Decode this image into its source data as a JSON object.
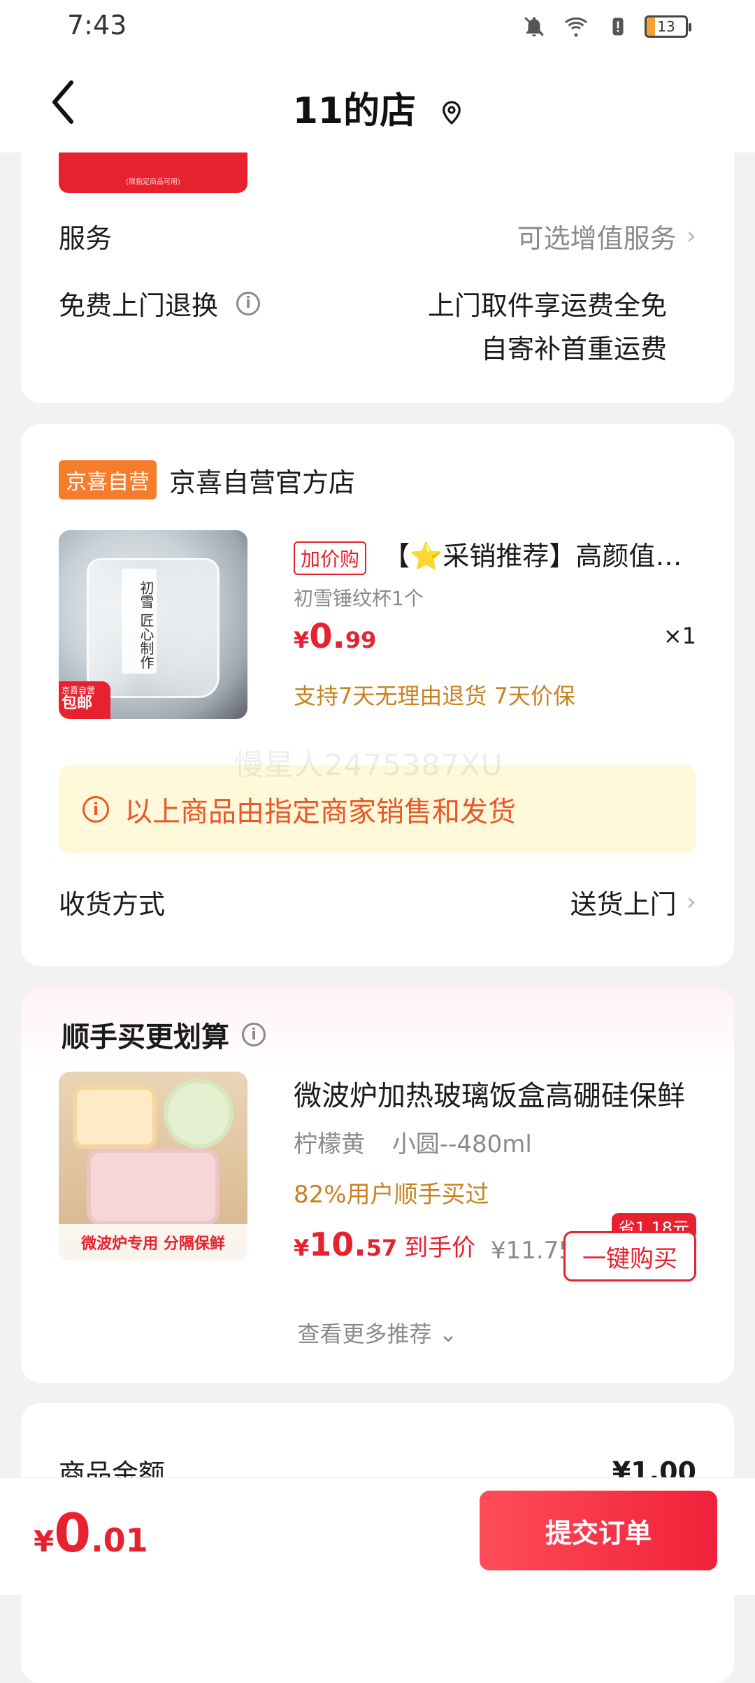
{
  "status_bar": {
    "time": "7:43",
    "battery": "13"
  },
  "nav": {
    "title": "11的店"
  },
  "card_a": {
    "coupon_note": "(限指定商品可用)",
    "service_label": "服务",
    "service_value": "可选增值服务",
    "return_label": "免费上门退换",
    "return_line1": "上门取件享运费全免",
    "return_line2": "自寄补首重运费"
  },
  "store": {
    "tag": "京喜自营",
    "name": "京喜自营官方店",
    "product_badge_top": "京喜自营",
    "product_badge_bottom": "包邮",
    "product_image_text": "初雪 匠心制作",
    "addbuy_tag": "加价购",
    "product_title": "【⭐采销推荐】高颜值初…",
    "product_sku": "初雪锤纹杯1个",
    "price_symbol": "¥",
    "price_int": "0.",
    "price_dec": "99",
    "qty": "×1",
    "guarantee": "支持7天无理由退货  7天价保",
    "notice": "以上商品由指定商家销售和发货",
    "delivery_label": "收货方式",
    "delivery_value": "送货上门"
  },
  "watermark": "慢星人2475387XU",
  "recommend": {
    "title": "顺手买更划算",
    "item_title": "微波炉加热玻璃饭盒高硼硅保鲜",
    "spec_color": "柠檬黄",
    "spec_size": "小圆--480ml",
    "bought": "82%用户顺手买过",
    "price_symbol": "¥",
    "price_int": "10.",
    "price_dec": "57",
    "price_label": "到手价",
    "original_price": "¥11.75",
    "save_badge": "省1.18元",
    "buy_button": "一键购买",
    "image_text": "微波炉专用 分隔保鲜",
    "more": "查看更多推荐"
  },
  "summary": {
    "amount_label": "商品金额",
    "amount_value": "¥1.00"
  },
  "bottom": {
    "price_symbol": "¥",
    "price_int": "0",
    "price_dec": ".01",
    "submit": "提交订单"
  },
  "colors": {
    "accent": "#e8212e",
    "warning": "#e8582a",
    "gold": "#c98220"
  }
}
